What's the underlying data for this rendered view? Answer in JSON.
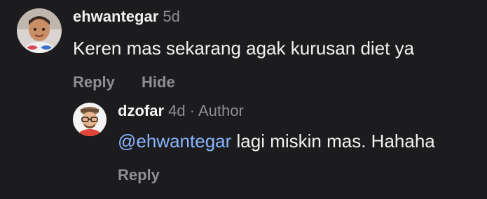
{
  "comments": [
    {
      "avatar_icon": "avatar-child-photo",
      "username": "ehwantegar",
      "time": "5d",
      "text": "Keren mas sekarang agak kurusan diet ya",
      "actions": {
        "reply": "Reply",
        "hide": "Hide"
      }
    },
    {
      "avatar_icon": "avatar-cartoon-person",
      "username": "dzofar",
      "time": "4d",
      "separator": "·",
      "author_tag": "Author",
      "mention": "@ehwantegar",
      "text": "lagi miskin mas. Hahaha",
      "actions": {
        "reply": "Reply"
      }
    }
  ],
  "colors": {
    "background": "#1c1c1e",
    "primary_text": "#f2f2f2",
    "secondary_text": "#8e8e93",
    "mention": "#8ab4ff"
  }
}
